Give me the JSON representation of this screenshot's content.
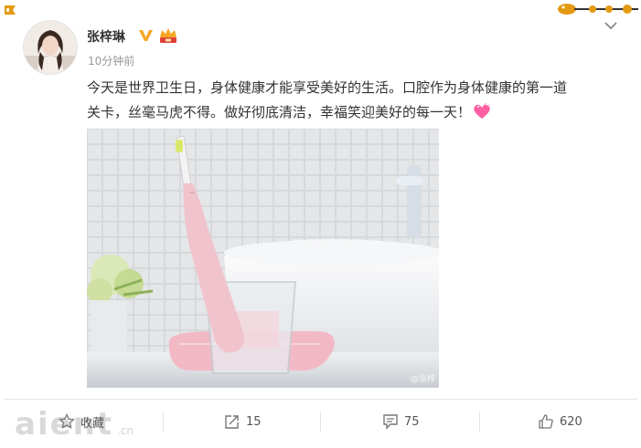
{
  "post": {
    "username": "张梓琳",
    "time": "10分钟前",
    "content_lines": [
      "今天是世界卫生日，身体健康才能享受美好的生活。口腔作为身体健康的第一道",
      "关卡，丝毫马虎不得。做好彻底清洁，幸福笑迎美好的每一天！"
    ],
    "image_watermark": "@张梓"
  },
  "actions": {
    "favorite_label": "收藏",
    "repost_count": "15",
    "comment_count": "75",
    "like_count": "620"
  },
  "site_watermark": {
    "text": "aient",
    "suffix": ".cn"
  },
  "colors": {
    "verified": "#f5a623",
    "emoji": "#ff5fa2",
    "accent": "#e8a000"
  },
  "icons": [
    "corner-badge-icon",
    "verified-icon",
    "vip-icon",
    "chevron-down-icon",
    "heart-emoji-icon",
    "star-icon",
    "repost-icon",
    "comment-icon",
    "thumbs-up-icon"
  ]
}
